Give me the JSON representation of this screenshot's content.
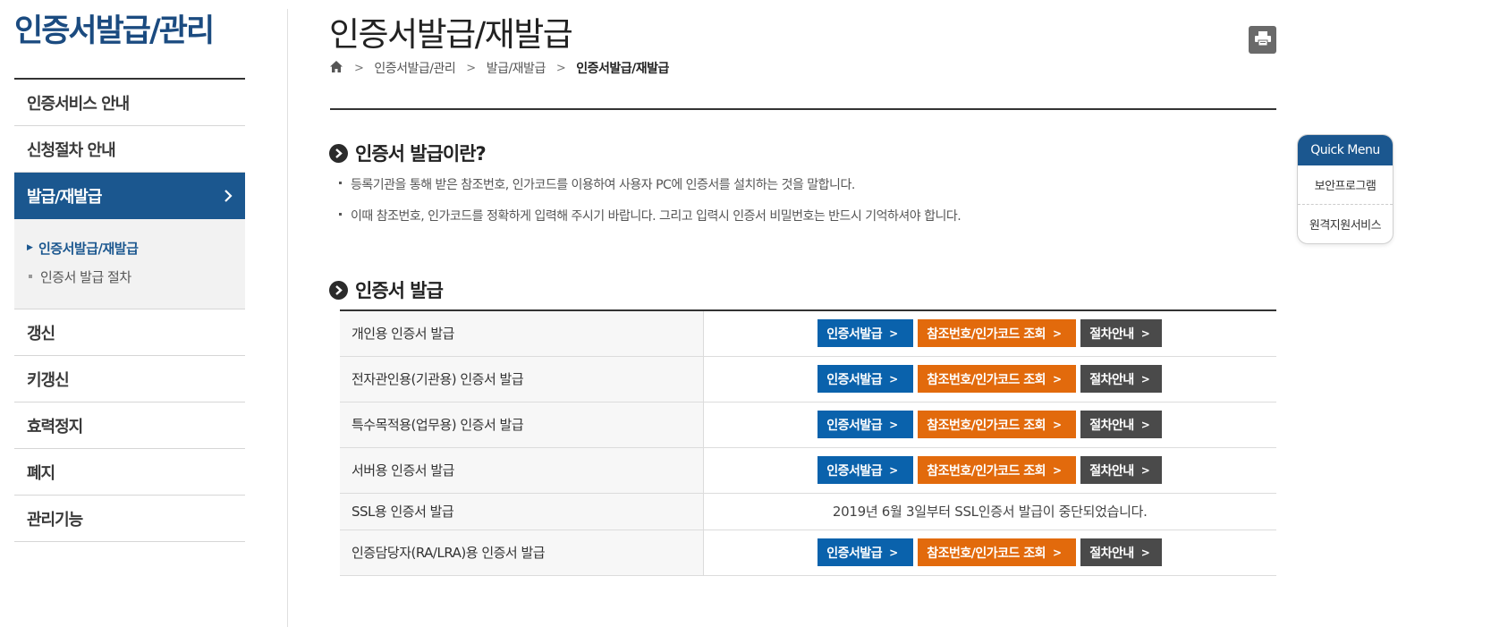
{
  "sidebar": {
    "title": "인증서발급/관리",
    "items": [
      {
        "label": "인증서비스 안내"
      },
      {
        "label": "신청절차 안내"
      },
      {
        "label": "발급/재발급"
      },
      {
        "label": "갱신"
      },
      {
        "label": "키갱신"
      },
      {
        "label": "효력정지"
      },
      {
        "label": "폐지"
      },
      {
        "label": "관리기능"
      }
    ],
    "subitems": [
      {
        "label": "인증서발급/재발급"
      },
      {
        "label": "인증서 발급 절차"
      }
    ]
  },
  "page": {
    "title": "인증서발급/재발급",
    "breadcrumb": [
      "인증서발급/관리",
      "발급/재발급",
      "인증서발급/재발급"
    ]
  },
  "section1": {
    "title": "인증서 발급이란?",
    "bullets": [
      "등록기관을 통해 받은 참조번호, 인가코드를 이용하여 사용자 PC에 인증서를 설치하는 것을 말합니다.",
      "이때 참조번호, 인가코드를 정확하게 입력해 주시기 바랍니다. 그리고 입력시 인증서 비밀번호는 반드시 기억하셔야 합니다."
    ]
  },
  "section2": {
    "title": "인증서 발급",
    "buttons": {
      "issue": "인증서발급",
      "lookup": "참조번호/인가코드 조회",
      "guide": "절차안내"
    },
    "rows": [
      {
        "label": "개인용 인증서 발급"
      },
      {
        "label": "전자관인용(기관용) 인증서 발급"
      },
      {
        "label": "특수목적용(업무용) 인증서 발급"
      },
      {
        "label": "서버용 인증서 발급"
      },
      {
        "label": "SSL용 인증서 발급",
        "notice": "2019년 6월 3일부터 SSL인증서 발급이 중단되었습니다."
      },
      {
        "label": "인증담당자(RA/LRA)용 인증서 발급"
      }
    ]
  },
  "quick_menu": {
    "title": "Quick Menu",
    "items": [
      "보안프로그램",
      "원격지원서비스"
    ]
  },
  "colors": {
    "brand_blue": "#1b578f",
    "button_blue": "#0a62ac",
    "button_orange": "#e26a0c",
    "button_dark": "#4a4a4a"
  },
  "icons": [
    "home-icon",
    "print-icon",
    "chevron-right-icon",
    "circle-arrow-icon"
  ]
}
